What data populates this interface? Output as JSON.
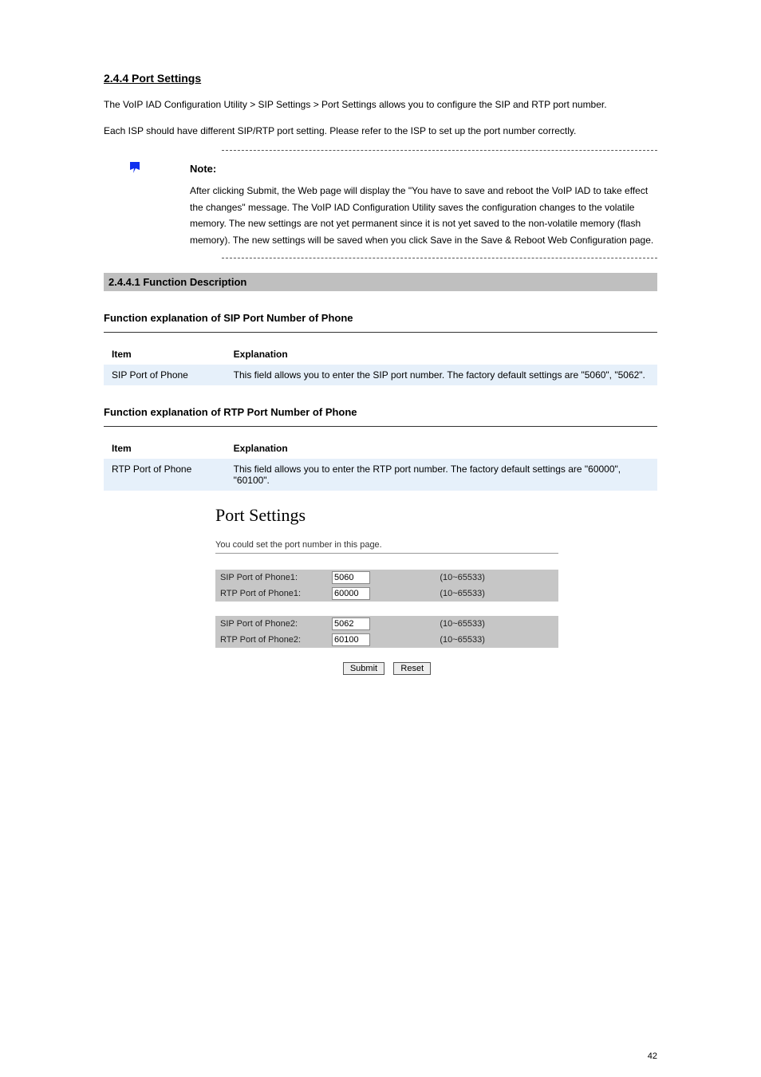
{
  "section_title": "2.4.4 Port Settings",
  "intro1": "The VoIP IAD Configuration Utility > SIP Settings > Port Settings allows you to configure the SIP and RTP port number.",
  "intro2": "Each ISP should have different SIP/RTP port setting. Please refer to the ISP to set up the port number correctly.",
  "note": {
    "title": "Note:",
    "text": "After clicking Submit, the Web page will display the \"You have to save and reboot the VoIP IAD to take effect the changes\" message. The VoIP IAD Configuration Utility saves the configuration changes to the volatile memory. The new settings are not yet permanent since it is not yet saved to the non-volatile memory (flash memory). The new settings will be saved when you click Save in the Save & Reboot Web Configuration page."
  },
  "h2": "2.4.4.1 Function Description",
  "func1_title": "Function explanation of SIP Port Number of Phone",
  "table_header_item": "Item",
  "table_header_exp": "Explanation",
  "func1": {
    "item": "SIP Port of Phone",
    "exp": "This field allows you to enter the SIP port number. The factory default settings are \"5060\", \"5062\"."
  },
  "func2_title": "Function explanation of RTP Port Number of Phone",
  "func2": {
    "item": "RTP Port of Phone",
    "exp": "This field allows you to enter the RTP port number. The factory default settings are \"60000\", \"60100\"."
  },
  "screenshot": {
    "title": "Port Settings",
    "sub": "You could set the port number in this page.",
    "rows1": [
      {
        "label": "SIP Port of Phone1:",
        "value": "5060",
        "range": "(10~65533)"
      },
      {
        "label": "RTP Port of Phone1:",
        "value": "60000",
        "range": "(10~65533)"
      }
    ],
    "rows2": [
      {
        "label": "SIP Port of Phone2:",
        "value": "5062",
        "range": "(10~65533)"
      },
      {
        "label": "RTP Port of Phone2:",
        "value": "60100",
        "range": "(10~65533)"
      }
    ],
    "submit": "Submit",
    "reset": "Reset"
  },
  "page_number": "42"
}
